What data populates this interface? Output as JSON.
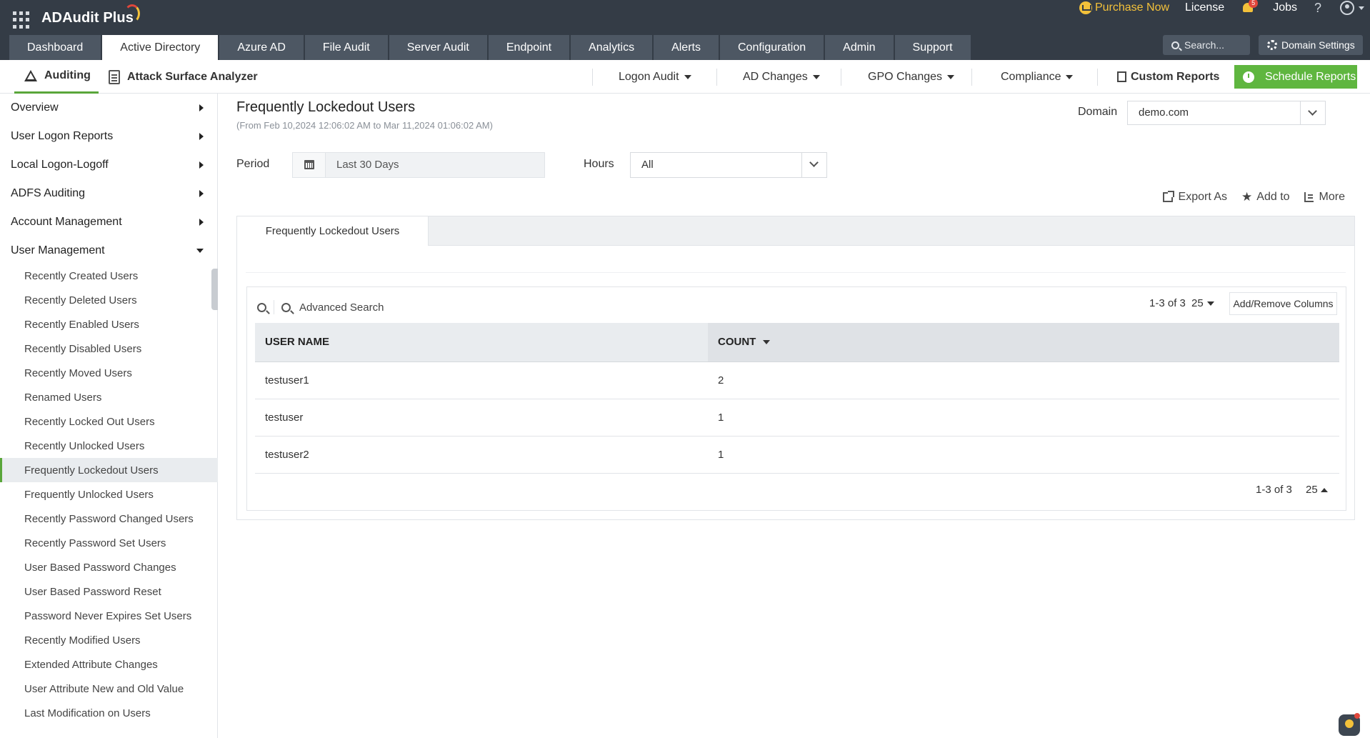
{
  "app": {
    "title": "ADAudit Plus"
  },
  "topbar": {
    "purchase_label": "Purchase Now",
    "license_label": "License",
    "notification_count": "5",
    "jobs_label": "Jobs",
    "help_label": "?",
    "search_placeholder": "Search...",
    "domain_settings_label": "Domain Settings"
  },
  "main_tabs": [
    {
      "label": "Dashboard"
    },
    {
      "label": "Active Directory"
    },
    {
      "label": "Azure AD"
    },
    {
      "label": "File Audit"
    },
    {
      "label": "Server Audit"
    },
    {
      "label": "Endpoint"
    },
    {
      "label": "Analytics"
    },
    {
      "label": "Alerts"
    },
    {
      "label": "Configuration"
    },
    {
      "label": "Admin"
    },
    {
      "label": "Support"
    }
  ],
  "subnav": {
    "auditing_label": "Auditing",
    "attack_label": "Attack Surface Analyzer",
    "menus": [
      {
        "label": "Logon Audit"
      },
      {
        "label": "AD Changes"
      },
      {
        "label": "GPO Changes"
      },
      {
        "label": "Compliance"
      }
    ],
    "custom_reports_label": "Custom Reports",
    "schedule_reports_label": "Schedule Reports"
  },
  "sidebar": {
    "sections": [
      {
        "label": "Overview"
      },
      {
        "label": "User Logon Reports"
      },
      {
        "label": "Local Logon-Logoff"
      },
      {
        "label": "ADFS Auditing"
      },
      {
        "label": "Account Management"
      },
      {
        "label": "User Management"
      }
    ],
    "items": [
      {
        "label": "Recently Created Users"
      },
      {
        "label": "Recently Deleted Users"
      },
      {
        "label": "Recently Enabled Users"
      },
      {
        "label": "Recently Disabled Users"
      },
      {
        "label": "Recently Moved Users"
      },
      {
        "label": "Renamed Users"
      },
      {
        "label": "Recently Locked Out Users"
      },
      {
        "label": "Recently Unlocked Users"
      },
      {
        "label": "Frequently Lockedout Users"
      },
      {
        "label": "Frequently Unlocked Users"
      },
      {
        "label": "Recently Password Changed Users"
      },
      {
        "label": "Recently Password Set Users"
      },
      {
        "label": "User Based Password Changes"
      },
      {
        "label": "User Based Password Reset"
      },
      {
        "label": "Password Never Expires Set Users"
      },
      {
        "label": "Recently Modified Users"
      },
      {
        "label": "Extended Attribute Changes"
      },
      {
        "label": "User Attribute New and Old Value"
      },
      {
        "label": "Last Modification on Users"
      }
    ],
    "active_item": "Frequently Lockedout Users"
  },
  "report": {
    "title": "Frequently Lockedout Users",
    "range": "(From Feb 10,2024 12:06:02 AM to Mar 11,2024 01:06:02 AM)",
    "domain_label": "Domain",
    "domain_value": "demo.com",
    "period_label": "Period",
    "period_value": "Last 30 Days",
    "hours_label": "Hours",
    "hours_value": "All",
    "actions": {
      "export": "Export As",
      "add_to": "Add to",
      "more": "More"
    },
    "tab_label": "Frequently Lockedout Users",
    "advanced_search": "Advanced Search",
    "pager": "1-3 of 3",
    "page_size": "25",
    "add_remove_columns": "Add/Remove Columns",
    "columns": [
      "USER NAME",
      "COUNT"
    ],
    "rows": [
      {
        "user": "testuser1",
        "count": "2"
      },
      {
        "user": "testuser",
        "count": "1"
      },
      {
        "user": "testuser2",
        "count": "1"
      }
    ]
  }
}
